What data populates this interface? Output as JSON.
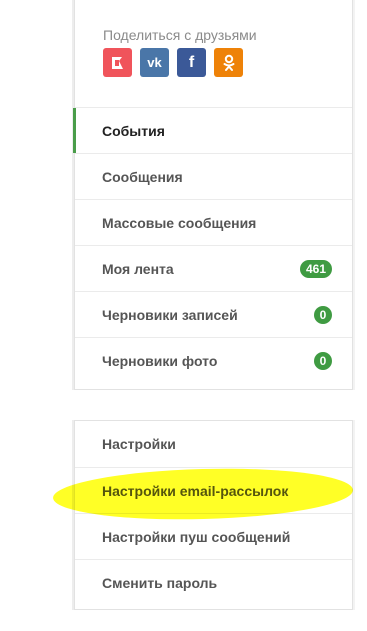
{
  "share": {
    "label": "Поделиться с друзьями",
    "buttons": [
      {
        "name": "flag-share-icon",
        "color": "#f0545b"
      },
      {
        "name": "vk-icon",
        "color": "#4a76a8",
        "text": "vk"
      },
      {
        "name": "facebook-icon",
        "color": "#3b5998",
        "text": "f"
      },
      {
        "name": "odnoklassniki-icon",
        "color": "#ee8208"
      }
    ]
  },
  "menu_top": {
    "items": [
      {
        "label": "События",
        "active": true
      },
      {
        "label": "Сообщения"
      },
      {
        "label": "Массовые сообщения"
      },
      {
        "label": "Моя лента",
        "badge": "461"
      },
      {
        "label": "Черновики записей",
        "badge": "0"
      },
      {
        "label": "Черновики фото",
        "badge": "0"
      }
    ]
  },
  "menu_bottom": {
    "items": [
      {
        "label": "Настройки"
      },
      {
        "label": "Настройки email-рассылок"
      },
      {
        "label": "Настройки пуш сообщений"
      },
      {
        "label": "Сменить пароль"
      }
    ]
  },
  "colors": {
    "accent_green": "#3f9b42",
    "highlight_yellow": "#ffff00"
  }
}
